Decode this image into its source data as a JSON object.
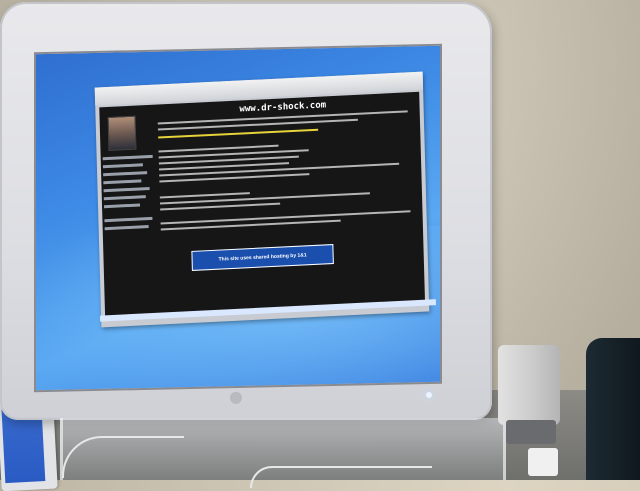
{
  "scene": {
    "colors": {
      "monitor_bezel": "#e9e9ec",
      "desktop_blue": "#3e8be6",
      "webpage_bg": "#161616",
      "highlight_text": "#e6d23a",
      "banner_blue": "#1b4fae"
    },
    "icons": [
      "apple-logo-icon",
      "power-led-icon"
    ]
  },
  "webpage": {
    "site_title": "www.dr-shock.com",
    "banner_text": "This site uses shared hosting by 1&1"
  }
}
